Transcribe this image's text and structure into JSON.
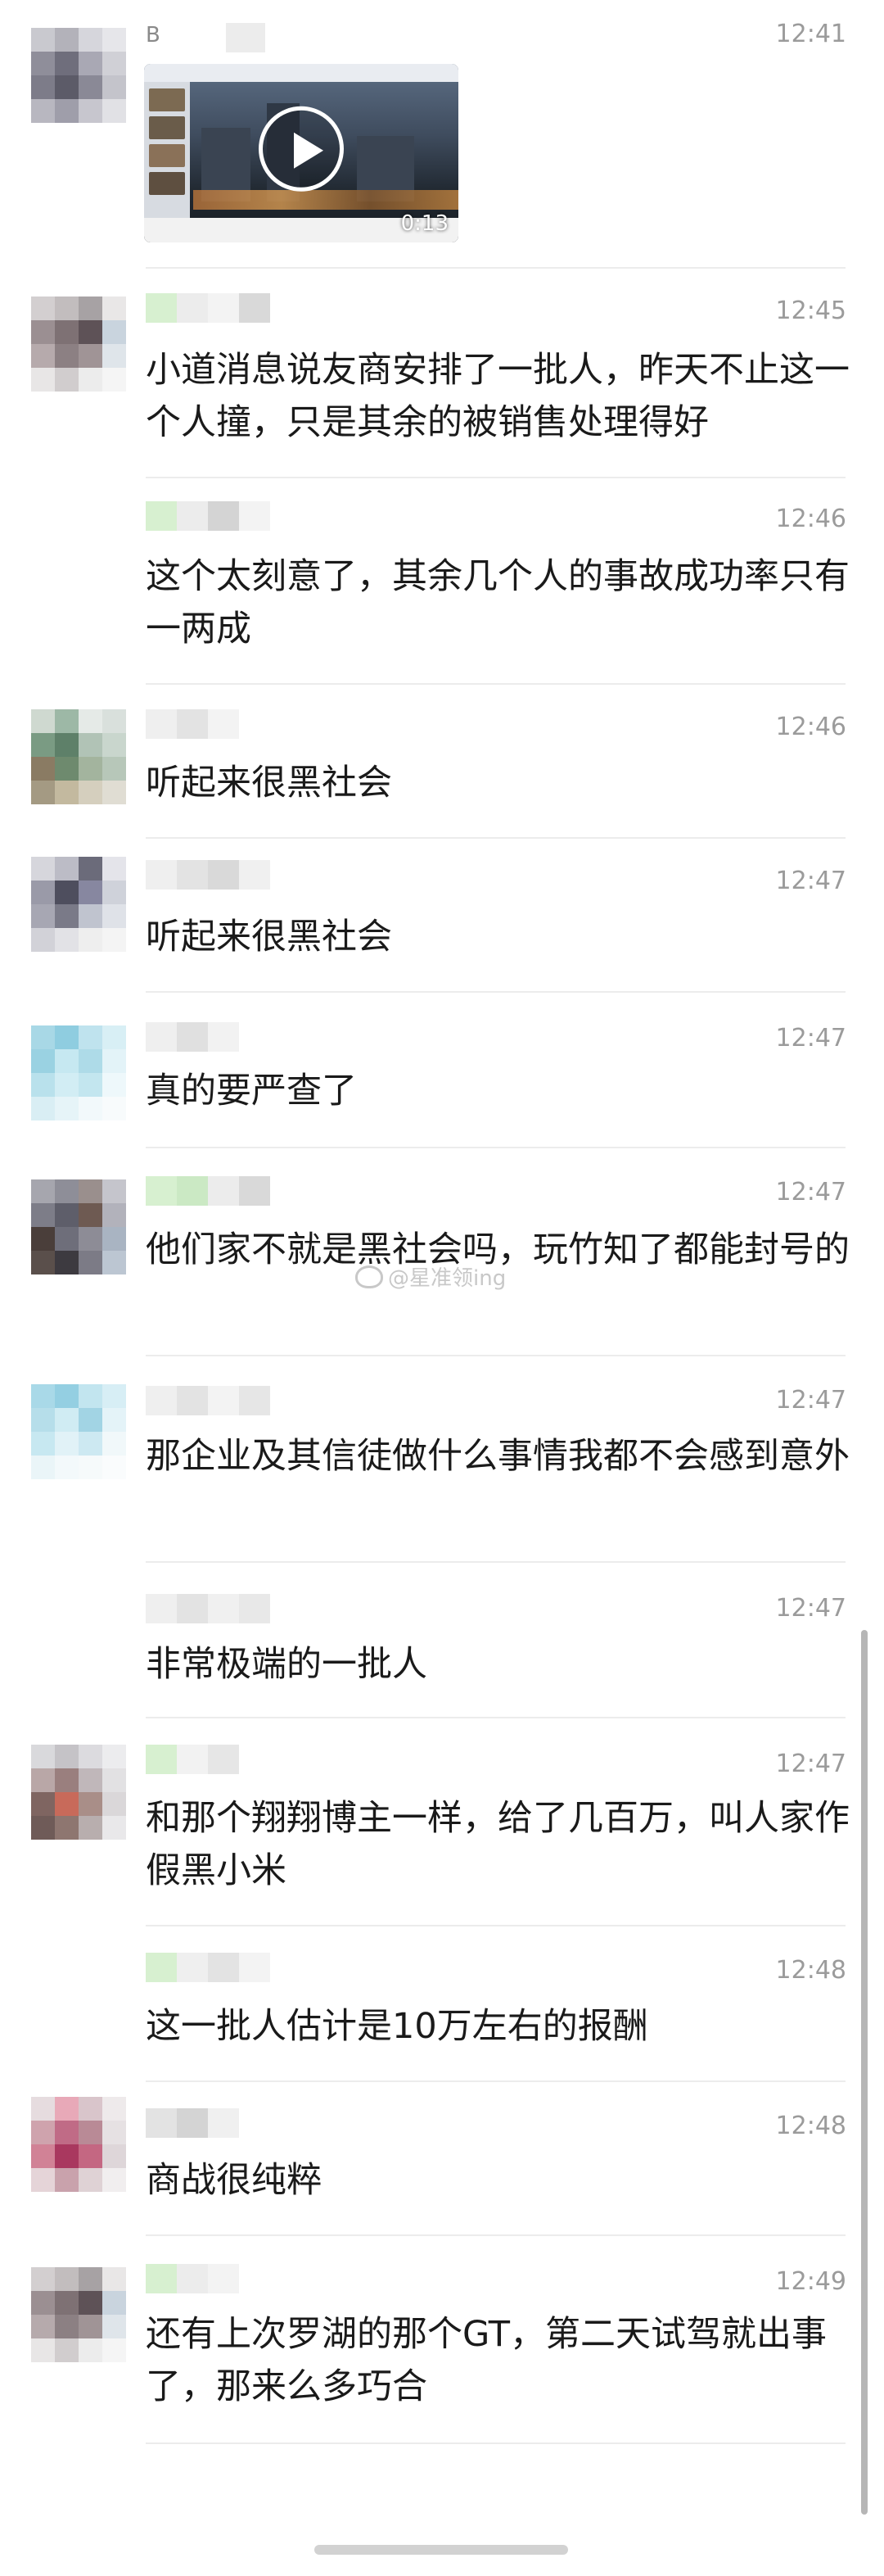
{
  "messages": [
    {
      "time": "12:41",
      "name_hint": "B",
      "video_duration": "0:13",
      "text": ""
    },
    {
      "time": "12:45",
      "text": "小道消息说友商安排了一批人，昨天不止这一个人撞，只是其余的被销售处理得好"
    },
    {
      "time": "12:46",
      "text": "这个太刻意了，其余几个人的事故成功率只有一两成"
    },
    {
      "time": "12:46",
      "text": "听起来很黑社会"
    },
    {
      "time": "12:47",
      "text": "听起来很黑社会"
    },
    {
      "time": "12:47",
      "text": "真的要严查了"
    },
    {
      "time": "12:47",
      "text": "他们家不就是黑社会吗，玩竹知了都能封号的"
    },
    {
      "time": "12:47",
      "text": "那企业及其信徒做什么事情我都不会感到意外"
    },
    {
      "time": "12:47",
      "text": "非常极端的一批人"
    },
    {
      "time": "12:47",
      "text": "和那个翔翔博主一样，给了几百万，叫人家作假黑小米"
    },
    {
      "time": "12:48",
      "text": "这一批人估计是10万左右的报酬"
    },
    {
      "time": "12:48",
      "text": "商战很纯粹"
    },
    {
      "time": "12:49",
      "text": "还有上次罗湖的那个GT，第二天试驾就出事了，那来么多巧合"
    }
  ],
  "watermark": "@星准领ing"
}
